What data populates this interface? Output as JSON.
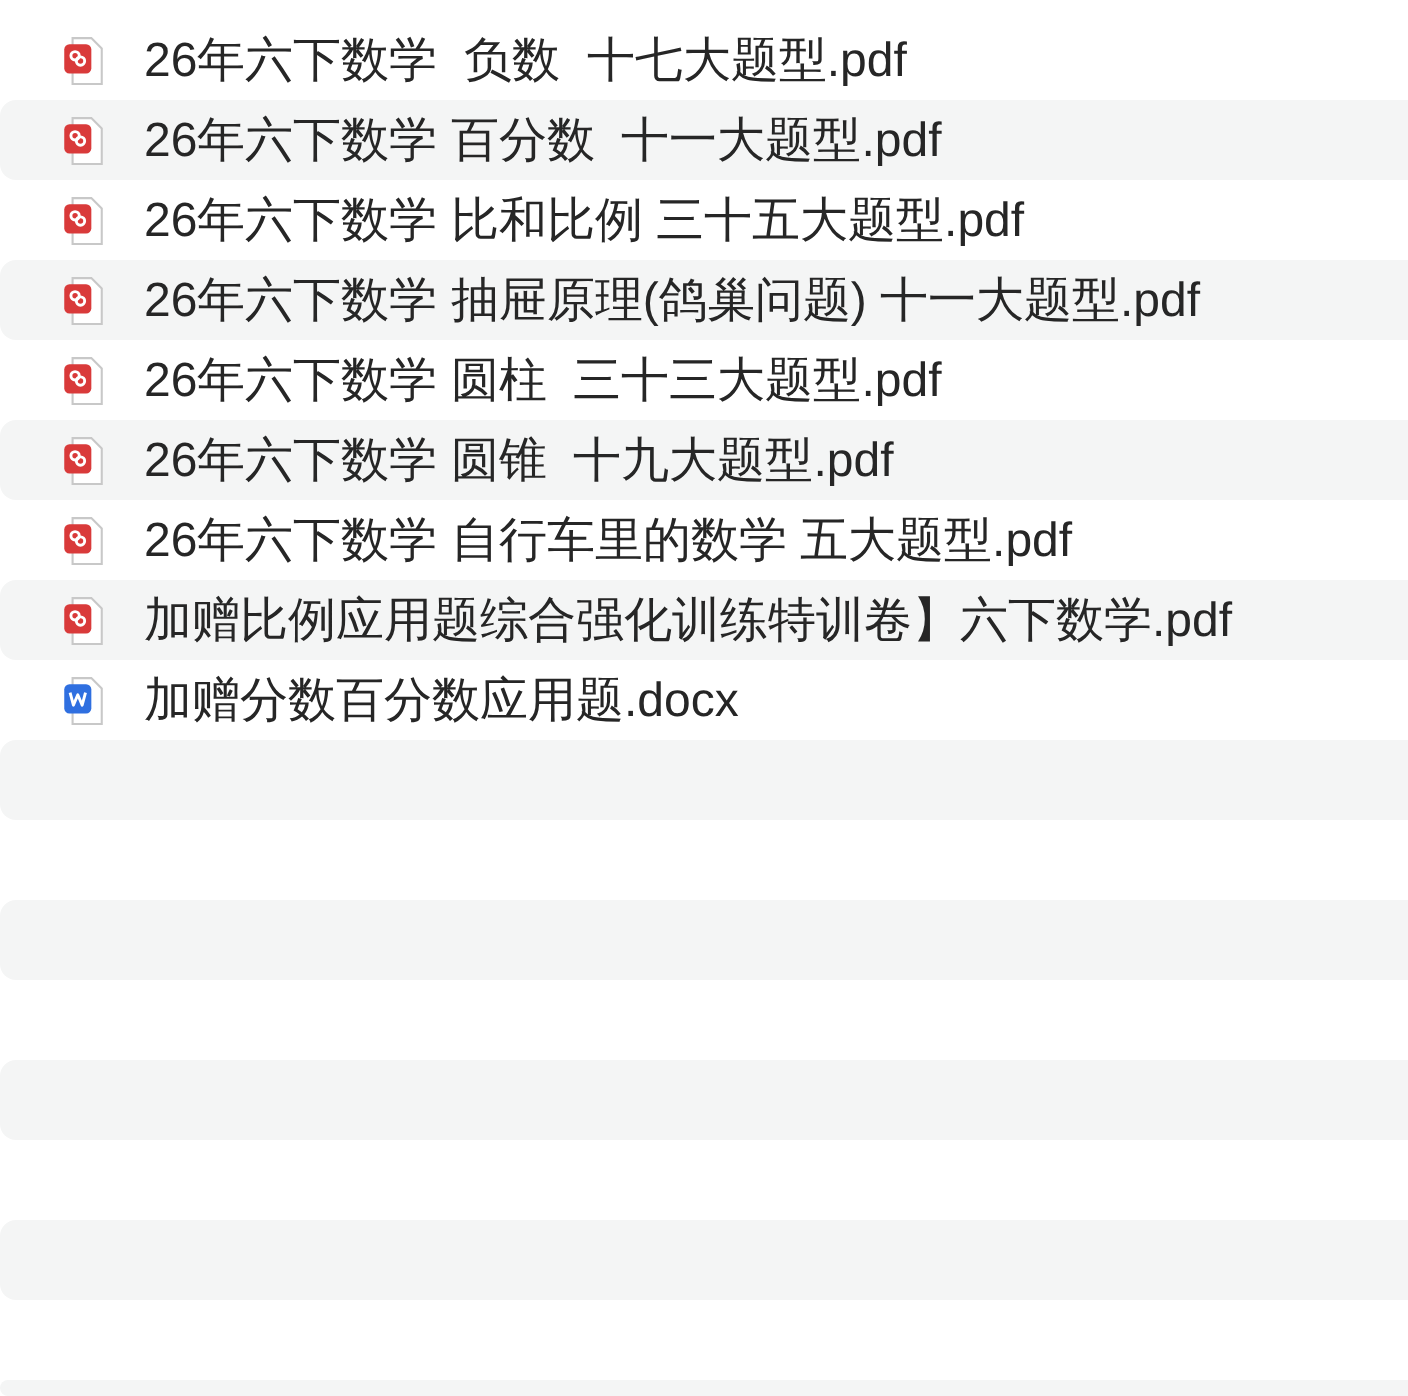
{
  "files": [
    {
      "kind": "pdf",
      "name": "26年六下数学  负数  十七大题型.pdf"
    },
    {
      "kind": "pdf",
      "name": "26年六下数学 百分数  十一大题型.pdf"
    },
    {
      "kind": "pdf",
      "name": "26年六下数学 比和比例 三十五大题型.pdf"
    },
    {
      "kind": "pdf",
      "name": "26年六下数学 抽屉原理(鸽巢问题) 十一大题型.pdf"
    },
    {
      "kind": "pdf",
      "name": "26年六下数学 圆柱  三十三大题型.pdf"
    },
    {
      "kind": "pdf",
      "name": "26年六下数学 圆锥  十九大题型.pdf"
    },
    {
      "kind": "pdf",
      "name": "26年六下数学 自行车里的数学 五大题型.pdf"
    },
    {
      "kind": "pdf",
      "name": "加赠比例应用题综合强化训练特训卷】六下数学.pdf"
    },
    {
      "kind": "word",
      "name": "加赠分数百分数应用题.docx"
    }
  ]
}
